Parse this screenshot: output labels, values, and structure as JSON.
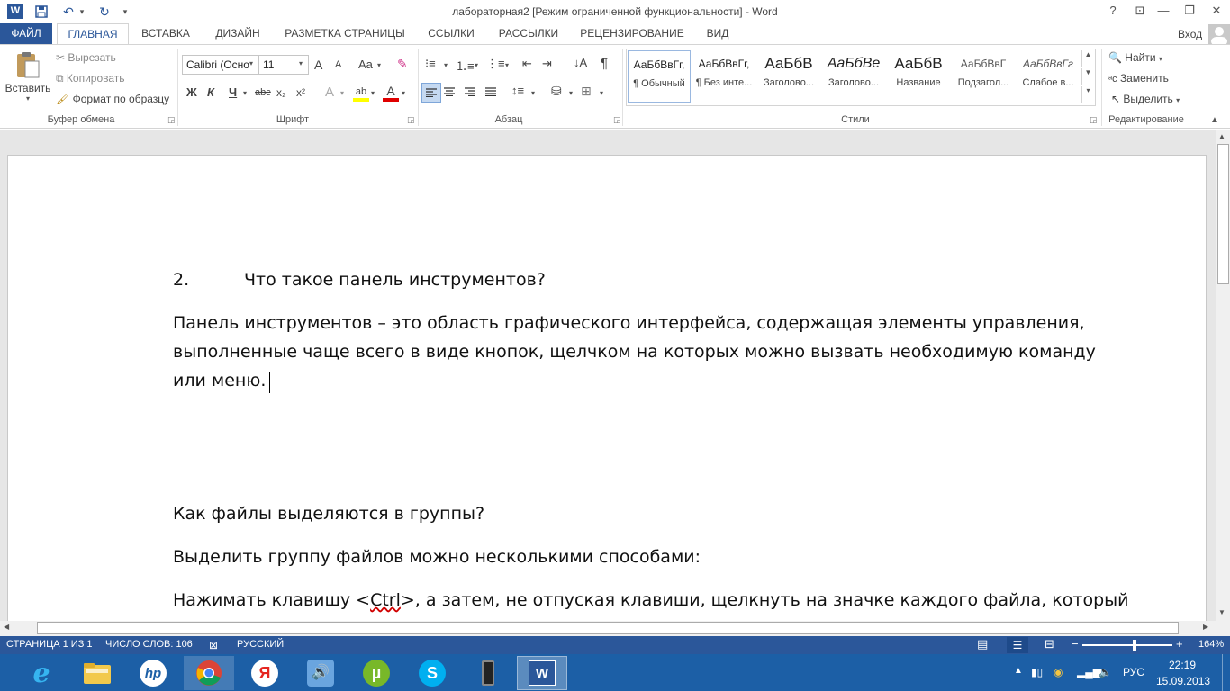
{
  "window": {
    "title": "лабораторная2 [Режим ограниченной функциональности] - Word",
    "help": "?",
    "login": "Вход"
  },
  "tabs": [
    "ФАЙЛ",
    "ГЛАВНАЯ",
    "ВСТАВКА",
    "ДИЗАЙН",
    "РАЗМЕТКА СТРАНИЦЫ",
    "ССЫЛКИ",
    "РАССЫЛКИ",
    "РЕЦЕНЗИРОВАНИЕ",
    "ВИД"
  ],
  "clipboard": {
    "paste": "Вставить",
    "cut": "Вырезать",
    "copy": "Копировать",
    "format_painter": "Формат по образцу",
    "group": "Буфер обмена"
  },
  "font": {
    "name": "Calibri (Осно",
    "size": "11",
    "bold": "Ж",
    "italic": "К",
    "underline": "Ч",
    "strike": "abc",
    "subscript": "x₂",
    "superscript": "x²",
    "grow": "A",
    "shrink": "A",
    "case": "Aa",
    "effects": "A",
    "highlight": "ab",
    "color": "A",
    "group": "Шрифт"
  },
  "paragraph": {
    "group": "Абзац",
    "pilcrow": "¶"
  },
  "styles": {
    "group": "Стили",
    "items": [
      {
        "preview": "АаБбВвГг,",
        "name": "¶ Обычный"
      },
      {
        "preview": "АаБбВвГг,",
        "name": "¶ Без инте..."
      },
      {
        "preview": "АаБбВ",
        "name": "Заголово..."
      },
      {
        "preview": "АаБбВе",
        "name": "Заголово..."
      },
      {
        "preview": "АаБбВ",
        "name": "Название"
      },
      {
        "preview": "АаБбВвГ",
        "name": "Подзагол..."
      },
      {
        "preview": "АаБбВвГг",
        "name": "Слабое в..."
      }
    ]
  },
  "editing": {
    "find": "Найти",
    "replace": "Заменить",
    "select": "Выделить",
    "group": "Редактирование"
  },
  "document": {
    "q_number": "2.",
    "q_text": "Что такое панель инструментов?",
    "para1_line1": "Панель инструментов – это область графического интерфейса, содержащая элементы управления,",
    "para1_line2": "выполненные чаще всего в виде кнопок, щелчком на которых можно вызвать необходимую команду",
    "para1_line3": "или меню.",
    "q2": "Как файлы выделяются в группы?",
    "para2": "Выделить группу файлов можно несколькими способами:",
    "para3_before": "Нажимать клавишу <",
    "para3_ctrl": "Ctrl",
    "para3_after": ">, а затем, не отпуская клавиши, щелкнуть на значке каждого файла, который"
  },
  "status": {
    "page": "СТРАНИЦА 1 ИЗ 1",
    "words": "ЧИСЛО СЛОВ: 106",
    "language": "РУССКИЙ",
    "zoom": "164%",
    "zoom_minus": "−",
    "zoom_plus": "+"
  },
  "taskbar": {
    "lang": "РУС",
    "time": "22:19",
    "date": "15.09.2013"
  },
  "colors": {
    "accent": "#2b579a",
    "taskbar": "#1c5fa6"
  }
}
